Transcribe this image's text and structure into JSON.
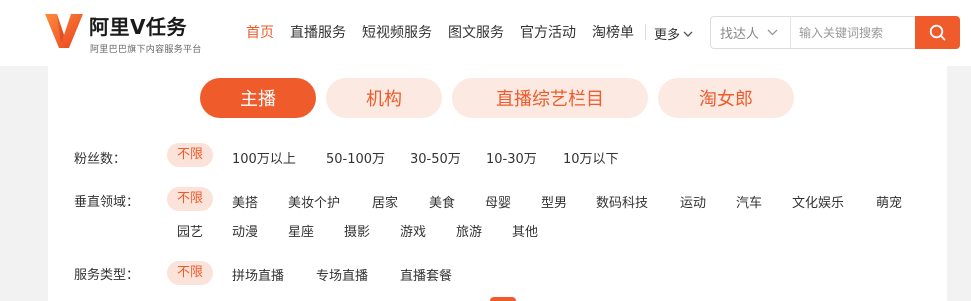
{
  "brand": {
    "title": "阿里V任务",
    "subtitle": "阿里巴巴旗下内容服务平台",
    "accent_color": "#ef5b2b"
  },
  "nav": {
    "items": [
      {
        "label": "首页",
        "active": true
      },
      {
        "label": "直播服务",
        "active": false
      },
      {
        "label": "短视频服务",
        "active": false
      },
      {
        "label": "图文服务",
        "active": false
      },
      {
        "label": "官方活动",
        "active": false
      },
      {
        "label": "淘榜单",
        "active": false
      }
    ],
    "more_label": "更多"
  },
  "search": {
    "scope_label": "找达人",
    "placeholder": "输入关键词搜索",
    "button_icon": "search-icon"
  },
  "category_tabs": [
    {
      "label": "主播",
      "active": true
    },
    {
      "label": "机构",
      "active": false
    },
    {
      "label": "直播综艺栏目",
      "active": false
    },
    {
      "label": "淘女郎",
      "active": false
    }
  ],
  "filters": {
    "fans": {
      "label": "粉丝数：",
      "options": [
        "不限",
        "100万以上",
        "50-100万",
        "30-50万",
        "10-30万",
        "10万以下"
      ]
    },
    "domain": {
      "label": "垂直领域：",
      "options": [
        "不限",
        "美搭",
        "美妆个护",
        "居家",
        "美食",
        "母婴",
        "型男",
        "数码科技",
        "运动",
        "汽车",
        "文化娱乐",
        "萌宠",
        "园艺",
        "动漫",
        "星座",
        "摄影",
        "游戏",
        "旅游",
        "其他"
      ]
    },
    "service": {
      "label": "服务类型：",
      "options": [
        "不限",
        "拼场直播",
        "专场直播",
        "直播套餐"
      ]
    }
  }
}
